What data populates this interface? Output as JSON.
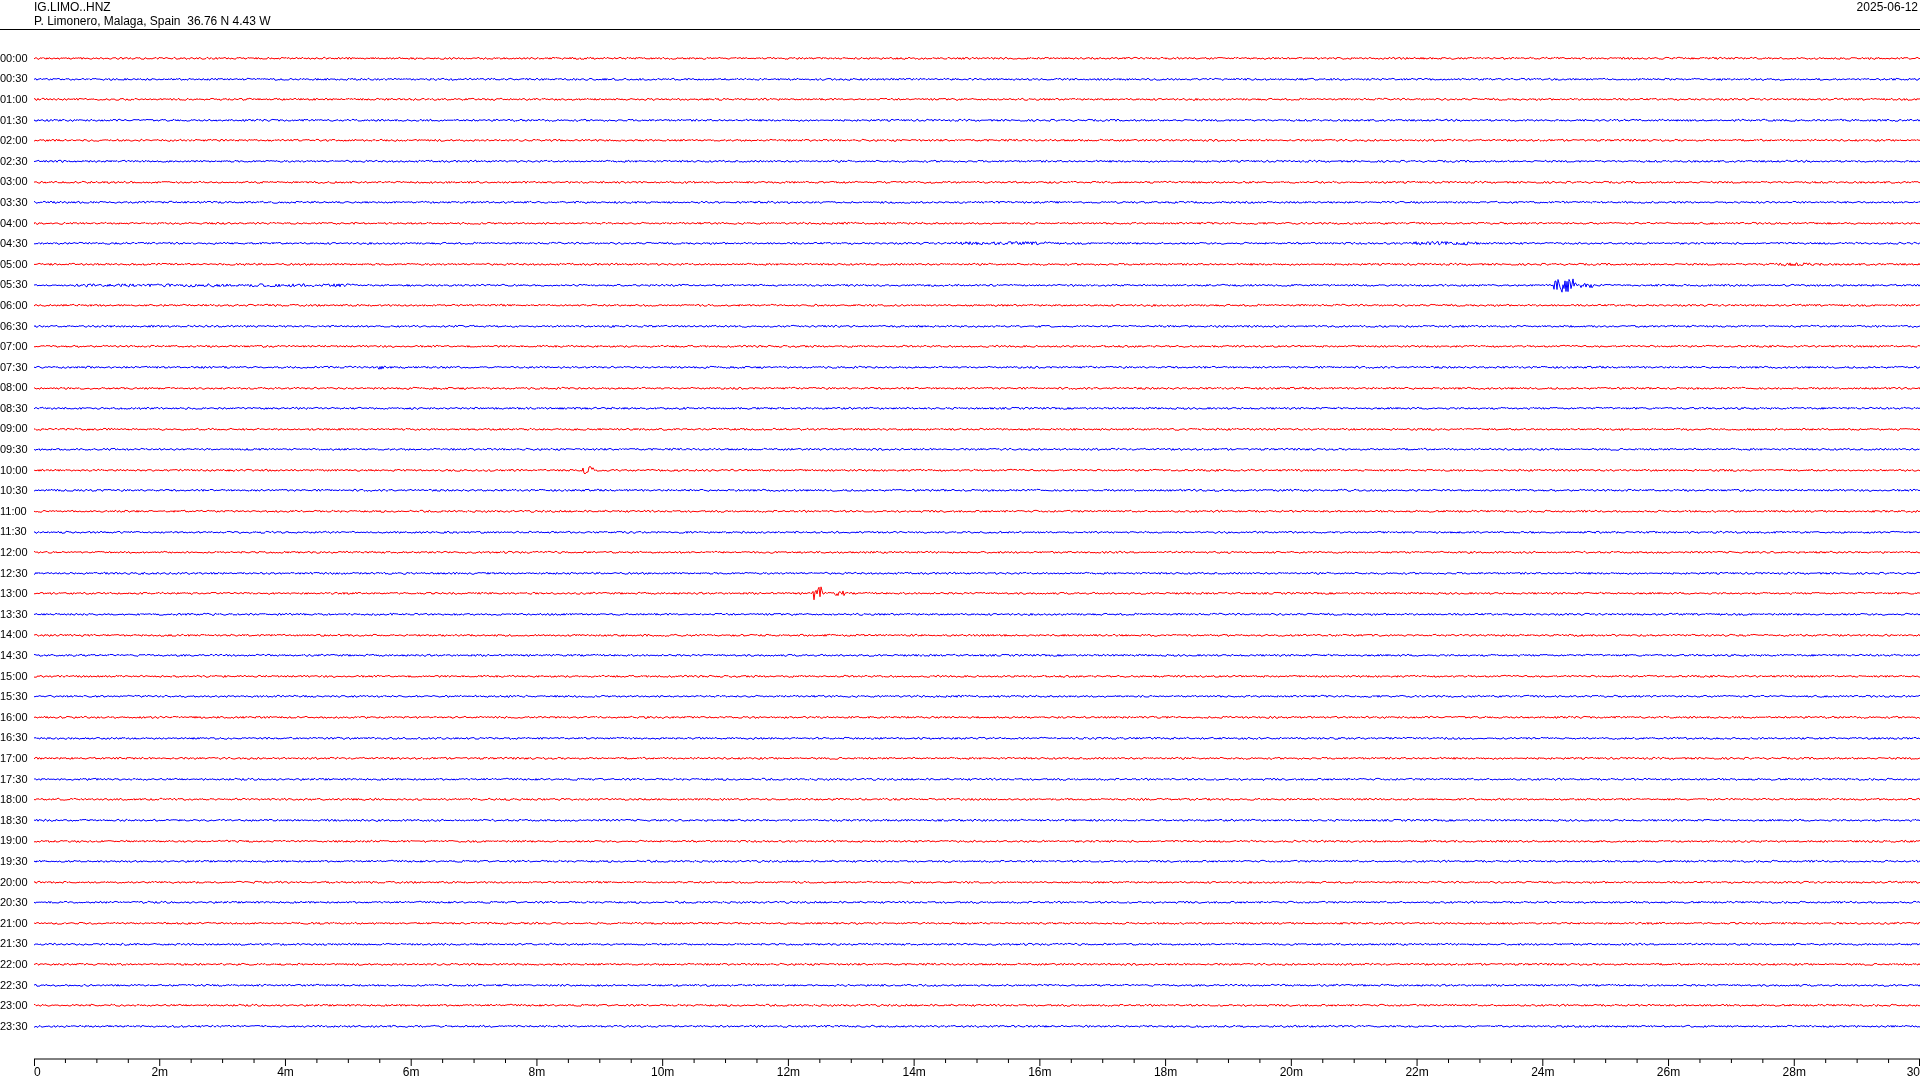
{
  "header": {
    "station": "IG.LIMO..HNZ",
    "location": "P. Limonero, Malaga, Spain  36.76 N 4.43 W",
    "date": "2025-06-12"
  },
  "rows": [
    {
      "label": "00:00",
      "color": "#ff0000"
    },
    {
      "label": "00:30",
      "color": "#0000ff"
    },
    {
      "label": "01:00",
      "color": "#ff0000"
    },
    {
      "label": "01:30",
      "color": "#0000ff"
    },
    {
      "label": "02:00",
      "color": "#ff0000"
    },
    {
      "label": "02:30",
      "color": "#0000ff"
    },
    {
      "label": "03:00",
      "color": "#ff0000"
    },
    {
      "label": "03:30",
      "color": "#0000ff"
    },
    {
      "label": "04:00",
      "color": "#ff0000"
    },
    {
      "label": "04:30",
      "color": "#0000ff"
    },
    {
      "label": "05:00",
      "color": "#ff0000"
    },
    {
      "label": "05:30",
      "color": "#0000ff"
    },
    {
      "label": "06:00",
      "color": "#ff0000"
    },
    {
      "label": "06:30",
      "color": "#0000ff"
    },
    {
      "label": "07:00",
      "color": "#ff0000"
    },
    {
      "label": "07:30",
      "color": "#0000ff"
    },
    {
      "label": "08:00",
      "color": "#ff0000"
    },
    {
      "label": "08:30",
      "color": "#0000ff"
    },
    {
      "label": "09:00",
      "color": "#ff0000"
    },
    {
      "label": "09:30",
      "color": "#0000ff"
    },
    {
      "label": "10:00",
      "color": "#ff0000"
    },
    {
      "label": "10:30",
      "color": "#0000ff"
    },
    {
      "label": "11:00",
      "color": "#ff0000"
    },
    {
      "label": "11:30",
      "color": "#0000ff"
    },
    {
      "label": "12:00",
      "color": "#ff0000"
    },
    {
      "label": "12:30",
      "color": "#0000ff"
    },
    {
      "label": "13:00",
      "color": "#ff0000"
    },
    {
      "label": "13:30",
      "color": "#0000ff"
    },
    {
      "label": "14:00",
      "color": "#ff0000"
    },
    {
      "label": "14:30",
      "color": "#0000ff"
    },
    {
      "label": "15:00",
      "color": "#ff0000"
    },
    {
      "label": "15:30",
      "color": "#0000ff"
    },
    {
      "label": "16:00",
      "color": "#ff0000"
    },
    {
      "label": "16:30",
      "color": "#0000ff"
    },
    {
      "label": "17:00",
      "color": "#ff0000"
    },
    {
      "label": "17:30",
      "color": "#0000ff"
    },
    {
      "label": "18:00",
      "color": "#ff0000"
    },
    {
      "label": "18:30",
      "color": "#0000ff"
    },
    {
      "label": "19:00",
      "color": "#ff0000"
    },
    {
      "label": "19:30",
      "color": "#0000ff"
    },
    {
      "label": "20:00",
      "color": "#ff0000"
    },
    {
      "label": "20:30",
      "color": "#0000ff"
    },
    {
      "label": "21:00",
      "color": "#ff0000"
    },
    {
      "label": "21:30",
      "color": "#0000ff"
    },
    {
      "label": "22:00",
      "color": "#ff0000"
    },
    {
      "label": "22:30",
      "color": "#0000ff"
    },
    {
      "label": "23:00",
      "color": "#ff0000"
    },
    {
      "label": "23:30",
      "color": "#0000ff"
    }
  ],
  "time_axis": {
    "labels": [
      "0",
      "2m",
      "4m",
      "6m",
      "8m",
      "10m",
      "12m",
      "14m",
      "16m",
      "18m",
      "20m",
      "22m",
      "24m",
      "26m",
      "28m",
      "30"
    ]
  }
}
